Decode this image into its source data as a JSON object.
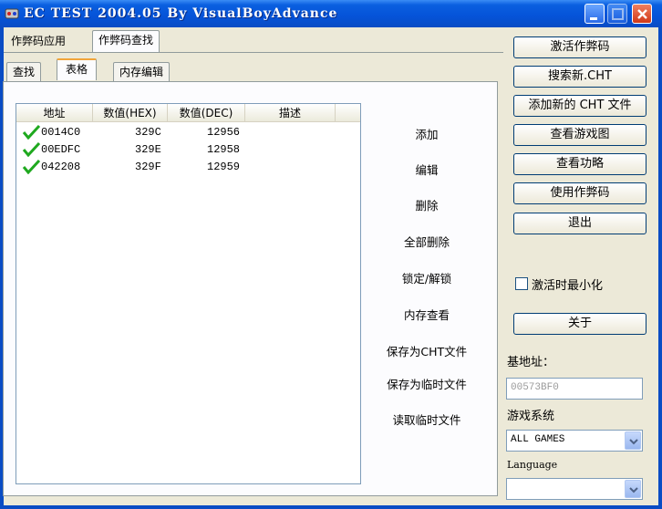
{
  "window": {
    "title": "EC TEST 2004.05  By VisualBoyAdvance"
  },
  "top_tabs": [
    {
      "label": "作弊码应用",
      "active": false
    },
    {
      "label": "作弊码查找",
      "active": true
    }
  ],
  "sub_tabs": [
    {
      "label": "查找",
      "active": false
    },
    {
      "label": "表格",
      "active": true
    },
    {
      "label": "内存编辑",
      "active": false
    }
  ],
  "table": {
    "columns": [
      "地址",
      "数值(HEX)",
      "数值(DEC)",
      "描述"
    ],
    "rows": [
      {
        "checked": true,
        "address": "0014C0",
        "hex": "329C",
        "dec": "12956",
        "desc": ""
      },
      {
        "checked": true,
        "address": "00EDFC",
        "hex": "329E",
        "dec": "12958",
        "desc": ""
      },
      {
        "checked": true,
        "address": "042208",
        "hex": "329F",
        "dec": "12959",
        "desc": ""
      }
    ]
  },
  "actions": [
    "添加",
    "编辑",
    "删除",
    "全部删除",
    "锁定/解锁",
    "内存查看",
    "保存为CHT文件",
    "保存为临时文件",
    "读取临时文件"
  ],
  "right_buttons": [
    "激活作弊码",
    "搜索新.CHT",
    "添加新的 CHT 文件",
    "查看游戏图",
    "查看功略",
    "使用作弊码",
    "退出"
  ],
  "minimize_on_activate": {
    "label": "激活时最小化",
    "checked": false
  },
  "about_button": "关于",
  "base_address": {
    "label": "基地址：",
    "value": "00573BF0"
  },
  "game_system": {
    "label": "游戏系统",
    "selected": "ALL GAMES"
  },
  "language": {
    "label": "Language",
    "selected": ""
  },
  "colors": {
    "titlebar": "#0553d8",
    "face": "#ece9d8",
    "check": "#1fa91f",
    "tab_highlight": "#f1a53a"
  }
}
